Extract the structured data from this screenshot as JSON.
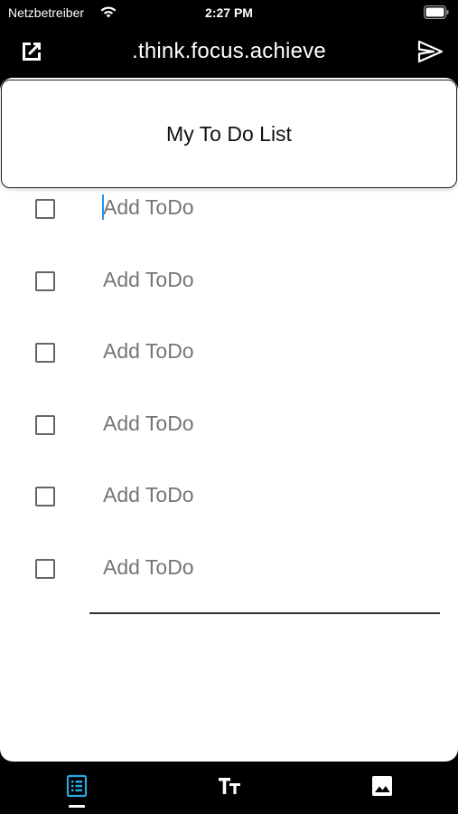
{
  "status_bar": {
    "carrier": "Netzbetreiber",
    "time": "2:27 PM"
  },
  "nav_bar": {
    "title": ".think.focus.achieve",
    "left_icon": "open-in-new-icon",
    "right_icon": "send-icon"
  },
  "list": {
    "title": "My To Do List",
    "items": [
      {
        "placeholder": "Add ToDo",
        "checked": false
      },
      {
        "placeholder": "Add ToDo",
        "checked": false
      },
      {
        "placeholder": "Add ToDo",
        "checked": false
      },
      {
        "placeholder": "Add ToDo",
        "checked": false
      },
      {
        "placeholder": "Add ToDo",
        "checked": false
      },
      {
        "placeholder": "Add ToDo",
        "checked": false
      }
    ]
  },
  "tab_bar": {
    "tabs": [
      {
        "icon": "list-icon",
        "active": true
      },
      {
        "icon": "text-format-icon",
        "active": false
      },
      {
        "icon": "image-icon",
        "active": false
      }
    ],
    "accent_color": "#29a8e0"
  }
}
